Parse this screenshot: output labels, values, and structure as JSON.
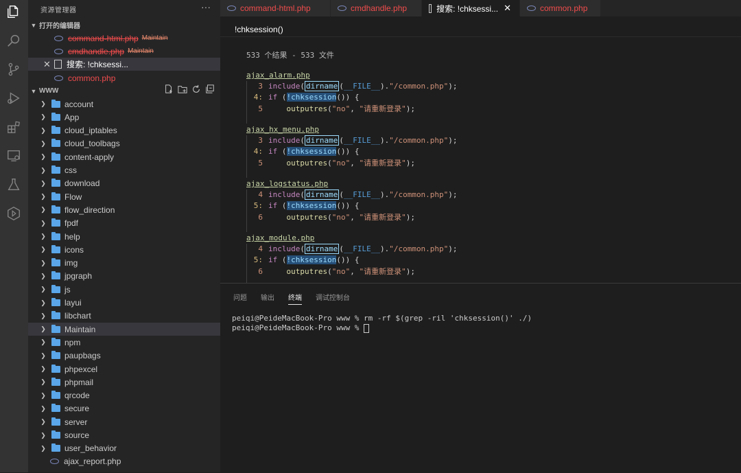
{
  "sidebar": {
    "title": "资源管理器",
    "more": "···",
    "open_editors_label": "打开的编辑器",
    "open_editors": [
      {
        "name": "command-html.php",
        "badge": "Maintain"
      },
      {
        "name": "cmdhandle.php",
        "badge": "Maintain"
      },
      {
        "name": "搜索: !chksessi...",
        "badge": ""
      },
      {
        "name": "common.php",
        "badge": ""
      }
    ],
    "workspace_label": "WWW",
    "tree": [
      {
        "name": "account"
      },
      {
        "name": "App"
      },
      {
        "name": "cloud_iptables"
      },
      {
        "name": "cloud_toolbags"
      },
      {
        "name": "content-apply"
      },
      {
        "name": "css"
      },
      {
        "name": "download"
      },
      {
        "name": "Flow"
      },
      {
        "name": "flow_direction"
      },
      {
        "name": "fpdf"
      },
      {
        "name": "help"
      },
      {
        "name": "icons"
      },
      {
        "name": "img"
      },
      {
        "name": "jpgraph"
      },
      {
        "name": "js"
      },
      {
        "name": "layui"
      },
      {
        "name": "libchart"
      },
      {
        "name": "Maintain"
      },
      {
        "name": "npm"
      },
      {
        "name": "paupbags"
      },
      {
        "name": "phpexcel"
      },
      {
        "name": "phpmail"
      },
      {
        "name": "qrcode"
      },
      {
        "name": "secure"
      },
      {
        "name": "server"
      },
      {
        "name": "source"
      },
      {
        "name": "user_behavior"
      }
    ],
    "last_file": "ajax_report.php"
  },
  "tabs": [
    {
      "label": "command-html.php",
      "type": "php"
    },
    {
      "label": "cmdhandle.php",
      "type": "php"
    },
    {
      "label": "搜索: !chksessi...",
      "type": "search"
    },
    {
      "label": "common.php",
      "type": "php"
    }
  ],
  "search": {
    "query": "!chksession()",
    "summary": "533 个结果 - 533 文件",
    "results": [
      {
        "file": "ajax_alarm.php",
        "lines": [
          {
            "n": "3",
            "hit": false,
            "code": "include(dirname(__FILE__).\"/common.php\");"
          },
          {
            "n": "4:",
            "hit": true,
            "code": "if (!chksession()) {"
          },
          {
            "n": "5",
            "hit": false,
            "code": "outputres(\"no\", \"请重新登录\");"
          }
        ]
      },
      {
        "file": "ajax_hx_menu.php",
        "lines": [
          {
            "n": "3",
            "hit": false,
            "code": "include(dirname(__FILE__).\"/common.php\");"
          },
          {
            "n": "4:",
            "hit": true,
            "code": "if (!chksession()) {"
          },
          {
            "n": "5",
            "hit": false,
            "code": "outputres(\"no\", \"请重新登录\");"
          }
        ]
      },
      {
        "file": "ajax_logstatus.php",
        "lines": [
          {
            "n": "4",
            "hit": false,
            "code": "include(dirname(__FILE__).\"/common.php\");"
          },
          {
            "n": "5:",
            "hit": true,
            "code": "if (!chksession()) {"
          },
          {
            "n": "6",
            "hit": false,
            "code": "outputres(\"no\", \"请重新登录\");"
          }
        ]
      },
      {
        "file": "ajax_module.php",
        "lines": [
          {
            "n": "4",
            "hit": false,
            "code": "include(dirname(__FILE__).\"/common.php\");"
          },
          {
            "n": "5:",
            "hit": true,
            "code": "if (!chksession()) {"
          },
          {
            "n": "6",
            "hit": false,
            "code": "outputres(\"no\", \"请重新登录\");"
          }
        ]
      }
    ]
  },
  "panel": {
    "tabs": [
      "问题",
      "输出",
      "终端",
      "调试控制台"
    ],
    "active_tab": "终端",
    "terminal": [
      "peiqi@PeideMacBook-Pro www % rm -rf $(grep -ril 'chksession()' ./)",
      "peiqi@PeideMacBook-Pro www % "
    ]
  }
}
